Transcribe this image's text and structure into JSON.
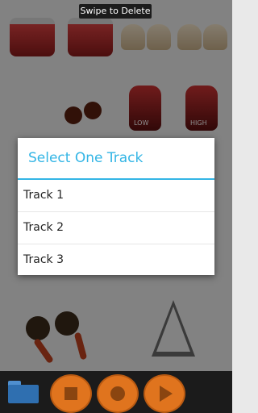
{
  "toast": {
    "text": "Swipe to Delete"
  },
  "dialog": {
    "title": "Select One Track",
    "tracks": [
      {
        "label": "Track 1"
      },
      {
        "label": "Track 2"
      },
      {
        "label": "Track 3"
      }
    ]
  },
  "instrument_labels": {
    "low": "LOW",
    "high": "HIGH"
  },
  "colors": {
    "accent": "#33b5e5",
    "button_orange": "#e0741e"
  },
  "bottom_bar": {
    "icons": [
      "folder-icon",
      "stop-icon",
      "record-icon",
      "play-icon"
    ]
  }
}
